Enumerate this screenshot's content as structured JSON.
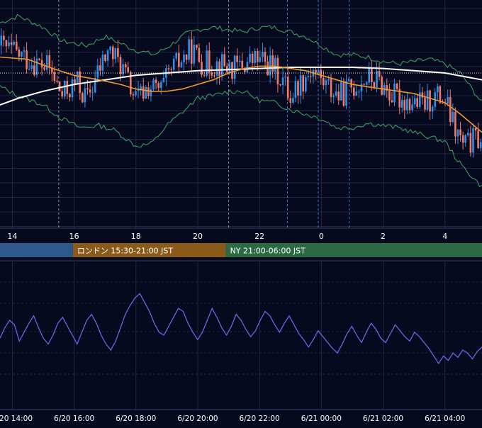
{
  "colors": {
    "background": "#070a1f",
    "grid": "#1e2744",
    "candle_up": "#2f8fe8",
    "candle_down": "#f07a6a",
    "sma_short": "#f2962f",
    "sma_long": "#ffffff",
    "bollinger": "#3aa865",
    "oscillator": "#6b6ff0",
    "session_tokyo": "#2d5a8a",
    "session_london": "#8a5a1a",
    "session_ny": "#2b6a45"
  },
  "sessions": [
    {
      "label": "",
      "color_key": "session_tokyo"
    },
    {
      "label": "ロンドン 15:30-21:00 JST",
      "color_key": "session_london"
    },
    {
      "label": "NY 21:00-06:00 JST",
      "color_key": "session_ny"
    }
  ],
  "chart_data": [
    {
      "type": "candlestick",
      "title": "",
      "x_tick_labels": [
        "14",
        "16",
        "18",
        "20",
        "22",
        "0",
        "2",
        "4"
      ],
      "x_tick_hours": [
        14,
        16,
        18,
        20,
        22,
        24,
        26,
        28
      ],
      "x_range_hours": [
        13.6,
        29.2
      ],
      "y_range": [
        0,
        100
      ],
      "reference_level": 68,
      "session_boundaries_hours": [
        15.5,
        21.0
      ],
      "news_event_hours": [
        22.9,
        23.9,
        24.9
      ],
      "candle_count": 190,
      "start_hour": 13.6,
      "close_path": [
        [
          13.6,
          80
        ],
        [
          14.5,
          74
        ],
        [
          15.2,
          70
        ],
        [
          15.6,
          58
        ],
        [
          16.1,
          64
        ],
        [
          16.4,
          56
        ],
        [
          16.7,
          66
        ],
        [
          17.1,
          78
        ],
        [
          17.5,
          72
        ],
        [
          18.0,
          56
        ],
        [
          18.4,
          62
        ],
        [
          18.8,
          60
        ],
        [
          19.2,
          70
        ],
        [
          19.5,
          74
        ],
        [
          19.8,
          78
        ],
        [
          20.2,
          72
        ],
        [
          20.7,
          72
        ],
        [
          21.2,
          70
        ],
        [
          21.5,
          72
        ],
        [
          21.9,
          74
        ],
        [
          22.3,
          72
        ],
        [
          22.7,
          66
        ],
        [
          23.0,
          58
        ],
        [
          23.3,
          64
        ],
        [
          23.7,
          70
        ],
        [
          24.2,
          62
        ],
        [
          24.6,
          58
        ],
        [
          25.0,
          62
        ],
        [
          25.5,
          66
        ],
        [
          25.9,
          64
        ],
        [
          26.3,
          58
        ],
        [
          26.8,
          56
        ],
        [
          27.3,
          54
        ],
        [
          27.7,
          58
        ],
        [
          28.0,
          56
        ],
        [
          28.3,
          44
        ],
        [
          28.6,
          36
        ],
        [
          29.2,
          40
        ]
      ],
      "sma_short": [
        [
          13.6,
          75
        ],
        [
          14.5,
          74
        ],
        [
          15.3,
          70
        ],
        [
          16.0,
          67
        ],
        [
          16.8,
          65
        ],
        [
          17.5,
          63
        ],
        [
          18.0,
          61
        ],
        [
          18.5,
          60
        ],
        [
          19.0,
          60
        ],
        [
          19.5,
          61
        ],
        [
          20.0,
          63
        ],
        [
          20.5,
          65
        ],
        [
          21.0,
          68
        ],
        [
          21.5,
          70
        ],
        [
          22.0,
          71
        ],
        [
          22.5,
          71
        ],
        [
          23.0,
          70
        ],
        [
          23.5,
          69
        ],
        [
          24.0,
          67
        ],
        [
          24.5,
          65
        ],
        [
          25.0,
          63
        ],
        [
          25.5,
          62
        ],
        [
          26.0,
          61
        ],
        [
          26.5,
          60
        ],
        [
          27.0,
          59
        ],
        [
          27.5,
          57
        ],
        [
          28.0,
          55
        ],
        [
          28.5,
          50
        ],
        [
          29.2,
          42
        ]
      ],
      "sma_long": [
        [
          13.6,
          54
        ],
        [
          14.2,
          57
        ],
        [
          15.0,
          60
        ],
        [
          16.0,
          63
        ],
        [
          17.0,
          65
        ],
        [
          18.0,
          67
        ],
        [
          19.0,
          68
        ],
        [
          20.0,
          69
        ],
        [
          21.0,
          69.5
        ],
        [
          22.0,
          70
        ],
        [
          23.0,
          70.5
        ],
        [
          24.0,
          70.5
        ],
        [
          25.0,
          70.5
        ],
        [
          26.0,
          70
        ],
        [
          27.0,
          69
        ],
        [
          28.0,
          68
        ],
        [
          29.2,
          65
        ]
      ],
      "bollinger_upper": [
        [
          13.6,
          90
        ],
        [
          14.2,
          93
        ],
        [
          15.0,
          88
        ],
        [
          15.6,
          82
        ],
        [
          16.4,
          80
        ],
        [
          17.0,
          84
        ],
        [
          17.5,
          81
        ],
        [
          18.0,
          78
        ],
        [
          18.6,
          76
        ],
        [
          19.1,
          80
        ],
        [
          19.6,
          85
        ],
        [
          20.0,
          87
        ],
        [
          20.5,
          88
        ],
        [
          21.0,
          87
        ],
        [
          21.5,
          86
        ],
        [
          22.0,
          88
        ],
        [
          22.5,
          88
        ],
        [
          23.0,
          86
        ],
        [
          23.5,
          84
        ],
        [
          24.0,
          80
        ],
        [
          24.5,
          76
        ],
        [
          25.0,
          76
        ],
        [
          25.5,
          75
        ],
        [
          26.0,
          73
        ],
        [
          26.5,
          72
        ],
        [
          27.0,
          73
        ],
        [
          27.5,
          74
        ],
        [
          28.0,
          72
        ],
        [
          28.5,
          68
        ],
        [
          29.2,
          55
        ]
      ],
      "bollinger_lower": [
        [
          13.6,
          62
        ],
        [
          14.2,
          58
        ],
        [
          15.0,
          54
        ],
        [
          15.6,
          48
        ],
        [
          16.2,
          44
        ],
        [
          16.8,
          45
        ],
        [
          17.3,
          43
        ],
        [
          18.0,
          36
        ],
        [
          18.5,
          37
        ],
        [
          19.0,
          45
        ],
        [
          19.6,
          52
        ],
        [
          20.0,
          57
        ],
        [
          20.5,
          58
        ],
        [
          21.0,
          60
        ],
        [
          21.5,
          60
        ],
        [
          22.0,
          56
        ],
        [
          22.5,
          55
        ],
        [
          23.0,
          52
        ],
        [
          23.5,
          50
        ],
        [
          24.0,
          48
        ],
        [
          24.5,
          44
        ],
        [
          25.0,
          44
        ],
        [
          25.5,
          46
        ],
        [
          26.0,
          45
        ],
        [
          26.5,
          44
        ],
        [
          27.0,
          42
        ],
        [
          27.5,
          40
        ],
        [
          28.0,
          38
        ],
        [
          28.5,
          28
        ],
        [
          29.2,
          18
        ]
      ]
    },
    {
      "type": "line",
      "title": "",
      "x_tick_labels": [
        "6/20 14:00",
        "6/20 16:00",
        "6/20 18:00",
        "6/20 20:00",
        "6/20 22:00",
        "6/21 00:00",
        "6/21 02:00",
        "6/21 04:00"
      ],
      "x_tick_hours": [
        14,
        16,
        18,
        20,
        22,
        24,
        26,
        28
      ],
      "x_range_hours": [
        13.6,
        29.2
      ],
      "y_range": [
        0,
        100
      ],
      "series": [
        {
          "values": [
            48,
            55,
            60,
            57,
            46,
            52,
            58,
            63,
            55,
            48,
            44,
            50,
            58,
            62,
            56,
            50,
            44,
            52,
            60,
            64,
            58,
            50,
            44,
            40,
            46,
            55,
            64,
            70,
            75,
            78,
            72,
            66,
            58,
            52,
            50,
            56,
            62,
            68,
            66,
            58,
            52,
            47,
            52,
            60,
            68,
            62,
            55,
            50,
            56,
            64,
            60,
            54,
            49,
            53,
            60,
            66,
            63,
            57,
            52,
            58,
            63,
            57,
            51,
            47,
            42,
            47,
            53,
            49,
            45,
            41,
            38,
            44,
            51,
            56,
            50,
            45,
            52,
            58,
            54,
            48,
            45,
            51,
            57,
            53,
            49,
            46,
            52,
            49,
            45,
            41,
            36,
            31,
            36,
            33,
            38,
            35,
            40,
            38,
            34,
            39,
            42
          ]
        }
      ]
    }
  ]
}
